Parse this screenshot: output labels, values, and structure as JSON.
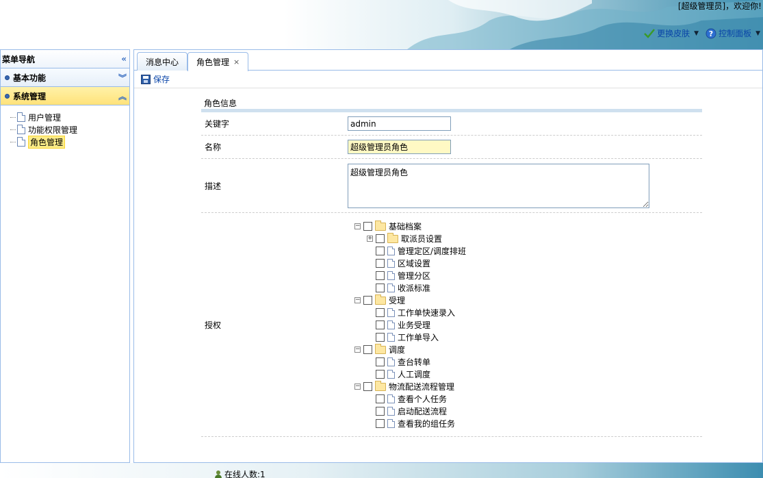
{
  "header": {
    "welcome": "[超级管理员]，欢迎你!",
    "links": [
      {
        "label": "更换皮肤",
        "icon": "checkmark-icon"
      },
      {
        "label": "控制面板",
        "icon": "help-icon"
      }
    ]
  },
  "nav": {
    "title": "菜单导航",
    "sections": [
      {
        "label": "基本功能",
        "state": "collapsed"
      },
      {
        "label": "系统管理",
        "state": "expanded"
      }
    ],
    "items": [
      {
        "label": "用户管理"
      },
      {
        "label": "功能权限管理"
      },
      {
        "label": "角色管理",
        "selected": true
      }
    ]
  },
  "tabs": [
    {
      "label": "消息中心"
    },
    {
      "label": "角色管理",
      "close": "×",
      "active": true
    }
  ],
  "toolbar": {
    "save_label": "保存"
  },
  "form": {
    "section_title": "角色信息",
    "keyword_label": "关键字",
    "keyword_value": "admin",
    "name_label": "名称",
    "name_value": "超级管理员角色",
    "desc_label": "描述",
    "desc_value": "超级管理员角色",
    "auth_label": "授权"
  },
  "auth_tree": [
    {
      "label": "基础档案",
      "children": [
        "取派员设置",
        "管理定区/调度排班",
        "区域设置",
        "管理分区",
        "收派标准"
      ]
    },
    {
      "label": "受理",
      "children": [
        "工作单快速录入",
        "业务受理",
        "工作单导入"
      ]
    },
    {
      "label": "调度",
      "children": [
        "查台转单",
        "人工调度"
      ]
    },
    {
      "label": "物流配送流程管理",
      "children": [
        "查看个人任务",
        "启动配送流程",
        "查看我的组任务"
      ]
    }
  ],
  "footer": {
    "online": "在线人数:1"
  },
  "colors": {
    "border": "#99bbe8",
    "accent": "#0a45a8",
    "active_section": "#ffe27a"
  }
}
